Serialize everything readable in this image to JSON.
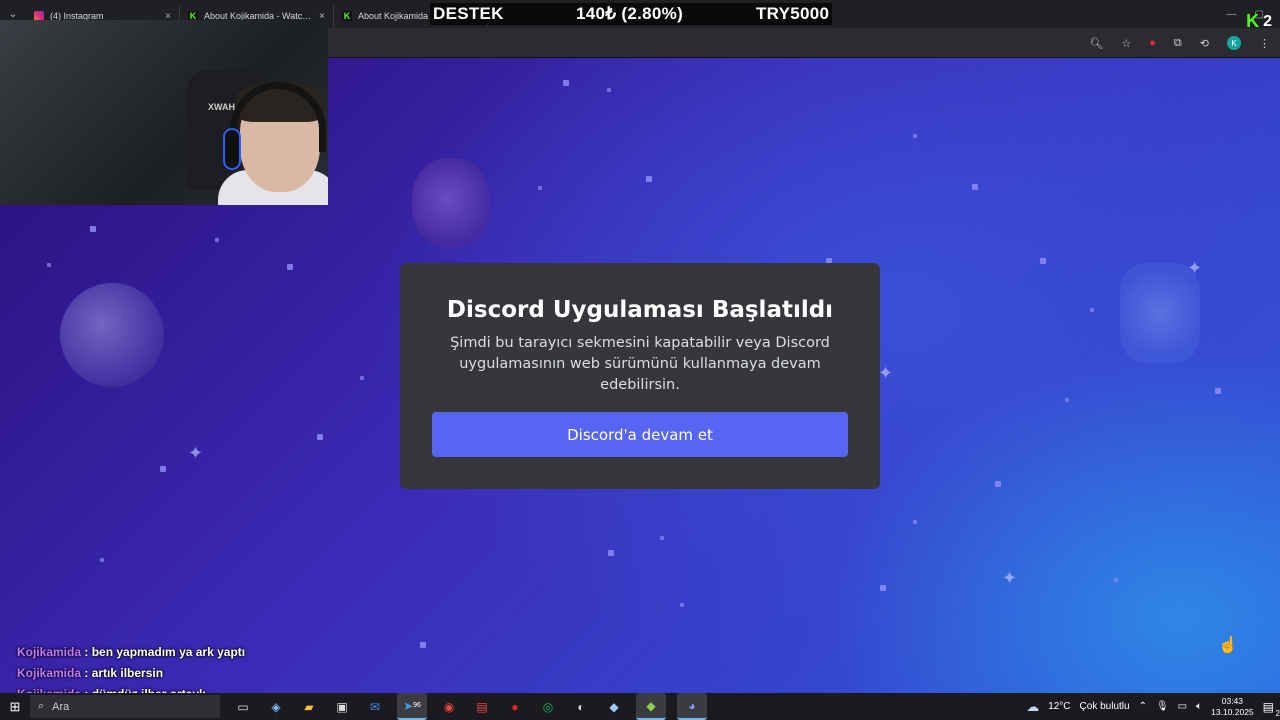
{
  "browser": {
    "tabs": [
      {
        "label": "(4) Instagram",
        "favicon": "instagram-icon"
      },
      {
        "label": "About Kojikamida - Watch Live",
        "favicon": "kick-icon"
      },
      {
        "label": "About Kojikamida",
        "favicon": "kick-icon"
      }
    ],
    "close_glyph": "×"
  },
  "overlay": {
    "ticker": {
      "left": "DESTEK",
      "middle": "140₺ (2.80%)",
      "right": "TRY5000"
    },
    "kick_count": "2"
  },
  "modal": {
    "title": "Discord Uygulaması Başlatıldı",
    "description": "Şimdi bu tarayıcı sekmesini kapatabilir veya Discord uygulamasının web sürümünü kullanmaya devam edebilirsin.",
    "button_label": "Discord'a devam et"
  },
  "webcam": {
    "chair_brand": "XWAH"
  },
  "chat": {
    "messages": [
      {
        "user": "Kojikamida",
        "text": ": ben yapmadım ya ark yaptı"
      },
      {
        "user": "Kojikamida",
        "text": ": artık ilbersin"
      },
      {
        "user": "Kojikamida",
        "text": ": dümdüz ilber ortaylı"
      }
    ]
  },
  "taskbar": {
    "search_placeholder": "Ara",
    "badge_count": "96",
    "weather": {
      "temp": "12°C",
      "condition": "Çok bulutlu"
    },
    "time": "03:43",
    "date": "13.10.2025",
    "notification_count": "2"
  },
  "colors": {
    "discord_blurple": "#5865f2",
    "modal_bg": "#36373d",
    "chat_username": "#c678ff",
    "kick_green": "#53fc18"
  }
}
